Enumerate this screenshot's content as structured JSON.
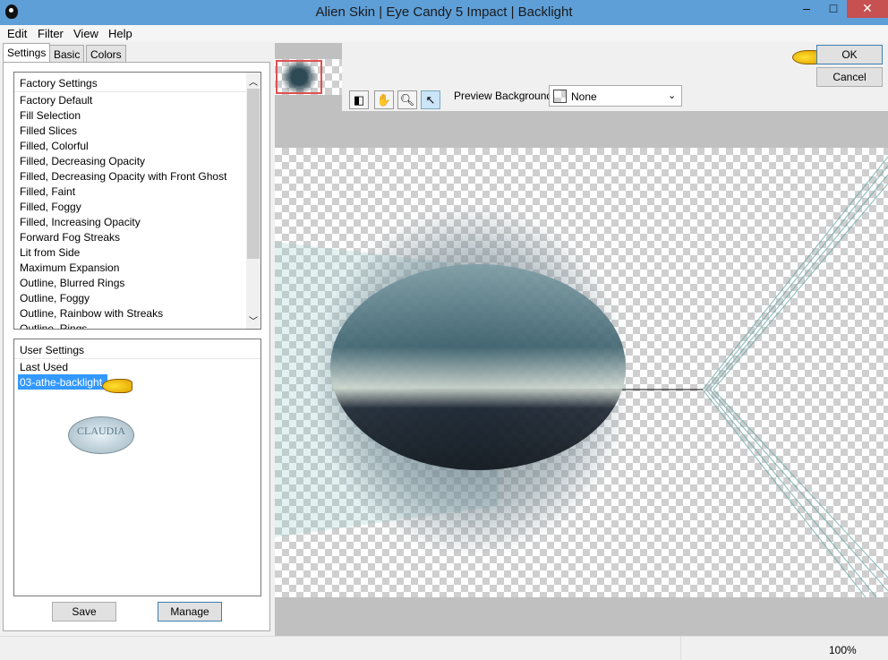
{
  "window": {
    "title": "Alien Skin | Eye Candy 5 Impact | Backlight",
    "minimize": "–",
    "maximize": "□",
    "close": "✕"
  },
  "menu": [
    "Edit",
    "Filter",
    "View",
    "Help"
  ],
  "tabs": [
    "Settings",
    "Basic",
    "Colors"
  ],
  "factory": {
    "header": "Factory Settings",
    "items": [
      "Factory Default",
      "Fill Selection",
      "Filled Slices",
      "Filled, Colorful",
      "Filled, Decreasing Opacity",
      "Filled, Decreasing Opacity with Front Ghost",
      "Filled, Faint",
      "Filled, Foggy",
      "Filled, Increasing Opacity",
      "Forward Fog Streaks",
      "Lit from Side",
      "Maximum Expansion",
      "Outline, Blurred Rings",
      "Outline, Foggy",
      "Outline, Rainbow with Streaks",
      "Outline, Rings"
    ]
  },
  "user": {
    "header": "User Settings",
    "items": [
      "Last Used",
      "03-athe-backlight"
    ],
    "selected": "03-athe-backlight",
    "watermark": "CLAUDIA"
  },
  "buttons": {
    "save": "Save",
    "manage": "Manage",
    "ok": "OK",
    "cancel": "Cancel"
  },
  "preview_background": {
    "label": "Preview Background:",
    "value": "None"
  },
  "status": {
    "zoom": "100%"
  },
  "colors": {
    "titlebar": "#5f9fd8",
    "selection": "#3399ff",
    "close": "#c75050"
  }
}
